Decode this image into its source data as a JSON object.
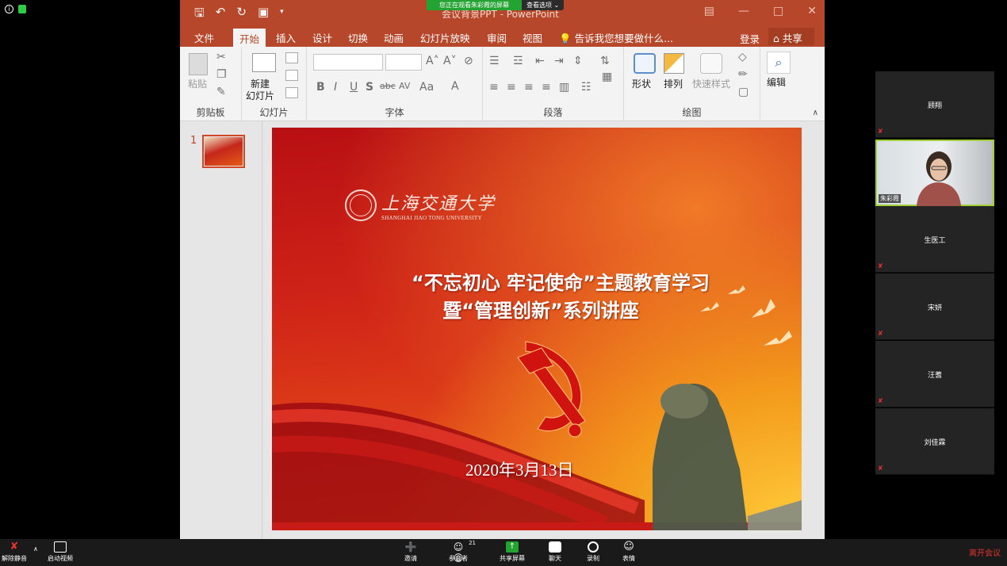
{
  "zoom": {
    "share_banner": {
      "viewing": "您正在观看朱彩霞的屏幕",
      "options": "查看选项 ⌄"
    }
  },
  "ppt": {
    "window_title": "会议背景PPT - PowerPoint",
    "tabs": [
      "文件",
      "开始",
      "插入",
      "设计",
      "切换",
      "动画",
      "幻灯片放映",
      "审阅",
      "视图"
    ],
    "active_tab": "开始",
    "tellme": "告诉我您想要做什么...",
    "login": "登录",
    "share": "共享",
    "ribbon": {
      "paste": "粘贴",
      "new_slide_1": "新建",
      "new_slide_2": "幻灯片",
      "shapes": "形状",
      "arrange": "排列",
      "quick_styles": "快速样式",
      "edit": "编辑",
      "groups": [
        "剪贴板",
        "幻灯片",
        "字体",
        "段落",
        "绘图"
      ]
    },
    "thumbnail_number": "1",
    "slide": {
      "university_cn": "上海交通大学",
      "university_en": "SHANGHAI JIAO TONG UNIVERSITY",
      "title_line1": "“不忘初心  牢记使命”主题教育学习",
      "title_line2": "暨“管理创新”系列讲座",
      "date": "2020年3月13日"
    }
  },
  "participants": [
    {
      "name": "顾翔",
      "video": false,
      "muted": true
    },
    {
      "name": "朱彩霞",
      "video": true,
      "muted": false
    },
    {
      "name": "生医工",
      "video": false,
      "muted": true
    },
    {
      "name": "宋妍",
      "video": false,
      "muted": true
    },
    {
      "name": "汪蓍",
      "video": false,
      "muted": true
    },
    {
      "name": "刘佳霖",
      "video": false,
      "muted": true
    }
  ],
  "toolbar": {
    "unmute": "解除静音",
    "start_video": "启动视频",
    "invite": "邀请",
    "participants": "参会者",
    "participants_count": "21",
    "share_screen": "共享屏幕",
    "chat": "聊天",
    "record": "录制",
    "reactions": "表情",
    "leave": "离开会议"
  },
  "colors": {
    "ppt_accent": "#b7472a",
    "zoom_green": "#23a331",
    "leave_red": "#e3342f"
  }
}
